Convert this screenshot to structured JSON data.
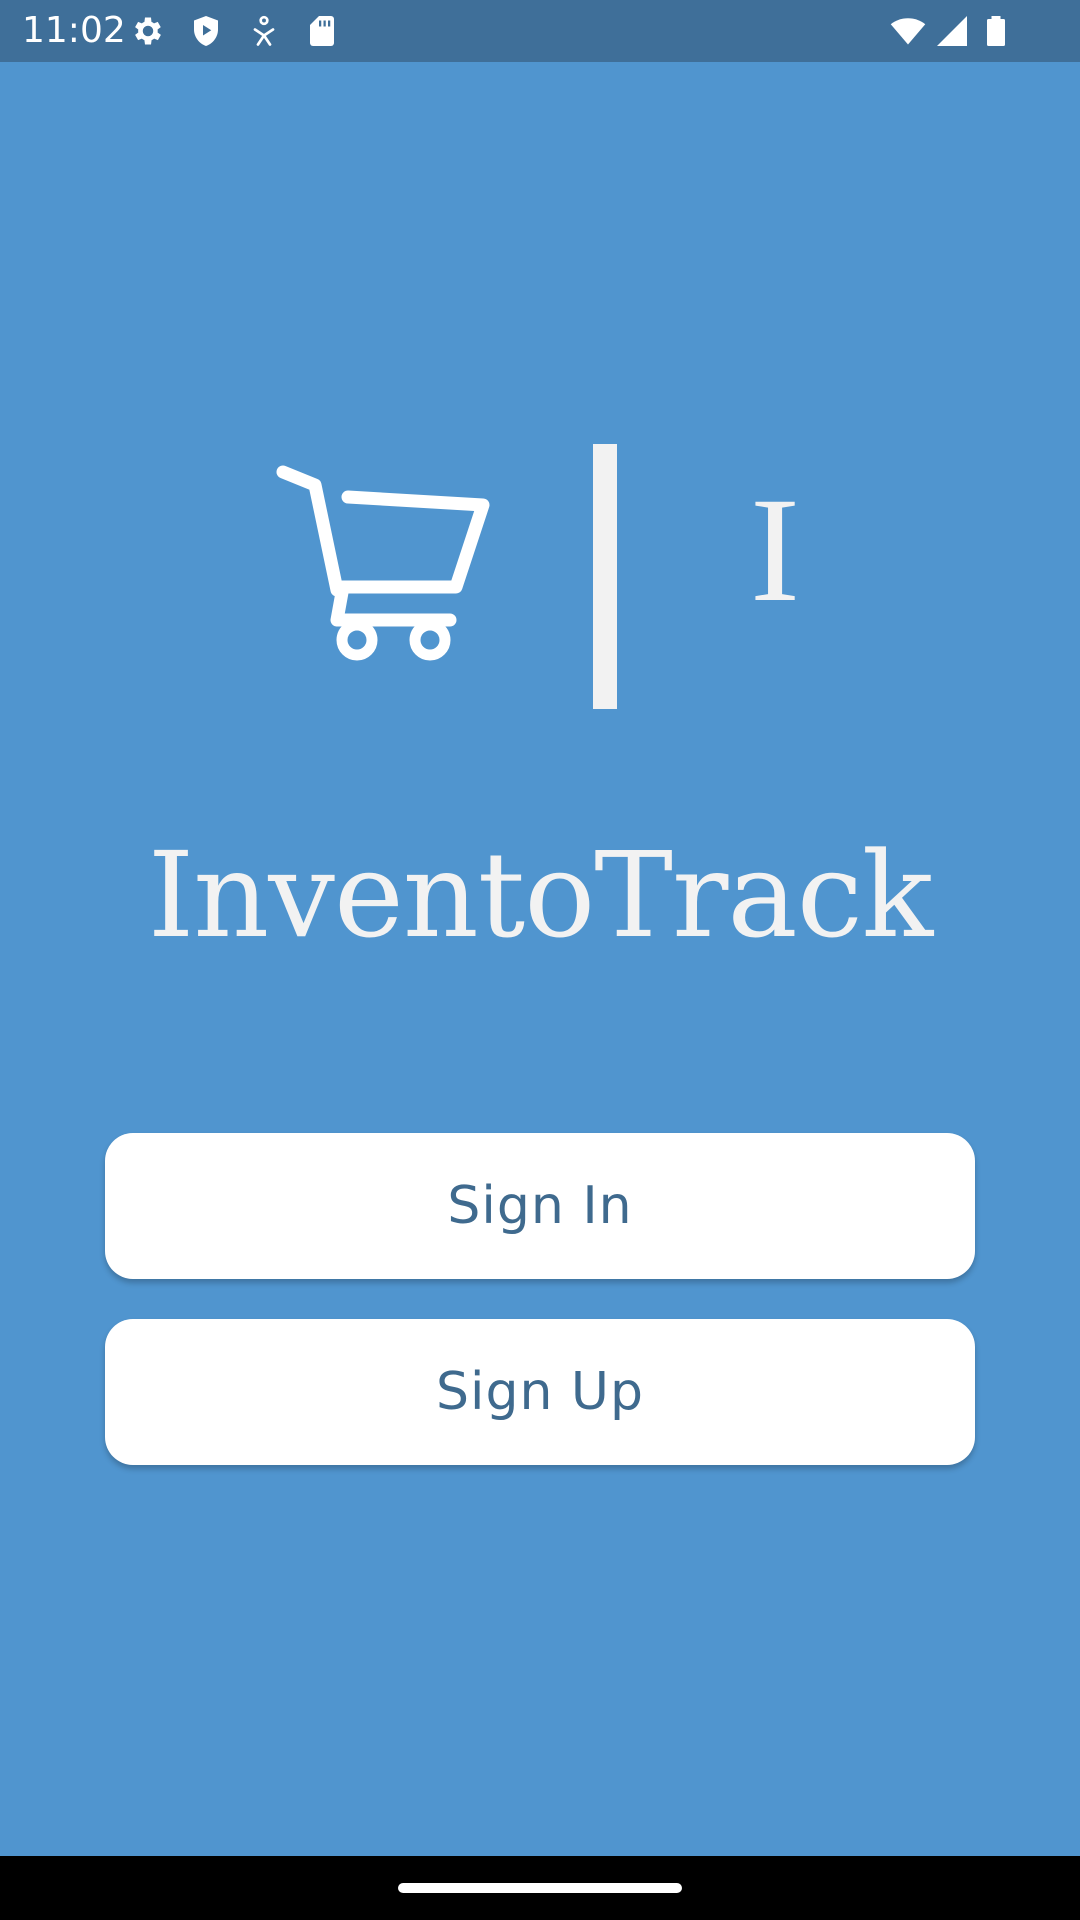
{
  "status_bar": {
    "time": "11:02",
    "left_icons": [
      "settings-icon",
      "shield-play-icon",
      "accessibility-icon",
      "sd-card-icon"
    ],
    "right_icons": [
      "wifi-icon",
      "signal-icon",
      "battery-icon"
    ]
  },
  "logo": {
    "icon": "shopping-cart-icon",
    "letter": "I"
  },
  "app_title": "InventoTrack",
  "buttons": {
    "sign_in": "Sign In",
    "sign_up": "Sign Up"
  },
  "colors": {
    "background": "#5095CF",
    "status_bar": "#3F6F99",
    "button_bg": "#FFFFFF",
    "button_text": "#3F6A8E",
    "logo": "#F2F2F2"
  }
}
